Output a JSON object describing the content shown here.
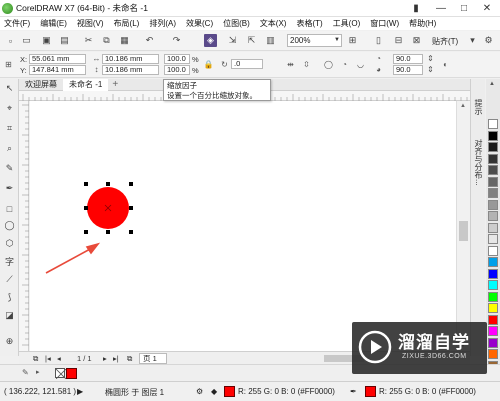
{
  "window": {
    "title": "CorelDRAW X7 (64-Bit) - 未命名 -1",
    "controls": [
      "minimize-icon",
      "maximize-icon",
      "close-icon"
    ]
  },
  "menu": {
    "items": [
      "文件(F)",
      "编辑(E)",
      "视图(V)",
      "布局(L)",
      "排列(A)",
      "效果(C)",
      "位图(B)",
      "文本(X)",
      "表格(T)",
      "工具(O)",
      "窗口(W)",
      "帮助(H)"
    ]
  },
  "toolbar": {
    "zoom_value": "200%",
    "snap_label": "贴齐(T)"
  },
  "propbar": {
    "x_label": "X:",
    "x_value": "55.061 mm",
    "y_label": "Y:",
    "y_value": "147.841 mm",
    "width_value": "10.186 mm",
    "height_value": "10.186 mm",
    "scale_x": "100.0",
    "scale_y": "100.0",
    "pct_x": "%",
    "pct_y": "%",
    "angle_value": ".0",
    "start_angle": "90.0",
    "end_angle": "90.0"
  },
  "tabs": {
    "welcome": "欢迎屏幕",
    "document": "未命名 -1"
  },
  "tooltip": {
    "title": "缩放因子",
    "body": "设置一个百分比缩放对象。"
  },
  "canvas": {
    "shape_color": "#FF0000",
    "arrow_color": "#E84A3A"
  },
  "docker": {
    "tab1": "提示",
    "tab2": "对齐与分布..."
  },
  "bottomnav": {
    "page_count": "1 / 1",
    "page_tab": "页 1"
  },
  "status": {
    "coords": "( 136.222, 121.581 )",
    "object_info": "椭圆形 于 图层 1",
    "fill_info": "R: 255 G: 0 B: 0 (#FF0000)",
    "outline_info": "R: 255 G: 0 B: 0 (#FF0000)"
  },
  "palette": {
    "colors": [
      "#ffffff",
      "#000000",
      "#1a1a1a",
      "#333333",
      "#4d4d4d",
      "#666666",
      "#808080",
      "#999999",
      "#b3b3b3",
      "#cccccc",
      "#e6e6e6",
      "#ffffff",
      "#00a0e9",
      "#0000ff",
      "#00ffff",
      "#00ff00",
      "#ffff00",
      "#ff0000",
      "#ff00ff",
      "#9900cc",
      "#ff6600",
      "#996633"
    ]
  },
  "watermark": {
    "main": "溜溜自学",
    "sub": "ZIXUE.3D66.COM"
  }
}
